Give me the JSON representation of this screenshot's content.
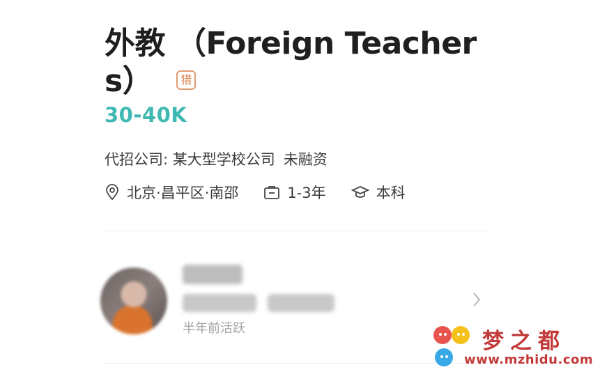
{
  "job": {
    "title_line1": "外教 （Foreign Teacher",
    "title_line2": "s）",
    "badge": "猎",
    "salary": "30-40K"
  },
  "company": {
    "prefix": "代招公司: 某大型学校公司",
    "funding": "未融资"
  },
  "meta": {
    "location": "北京·昌平区·南邵",
    "experience": "1-3年",
    "education": "本科"
  },
  "recruiter": {
    "active_status": "半年前活跃"
  },
  "watermark": {
    "brand": "梦之都",
    "url": "www.mzhidu.com"
  },
  "colors": {
    "salary": "#3fb9b2",
    "badge": "#d9834f",
    "watermark": "#c33a3a"
  },
  "icons": [
    "location-pin-icon",
    "briefcase-icon",
    "graduation-cap-icon",
    "chevron-right-icon"
  ]
}
